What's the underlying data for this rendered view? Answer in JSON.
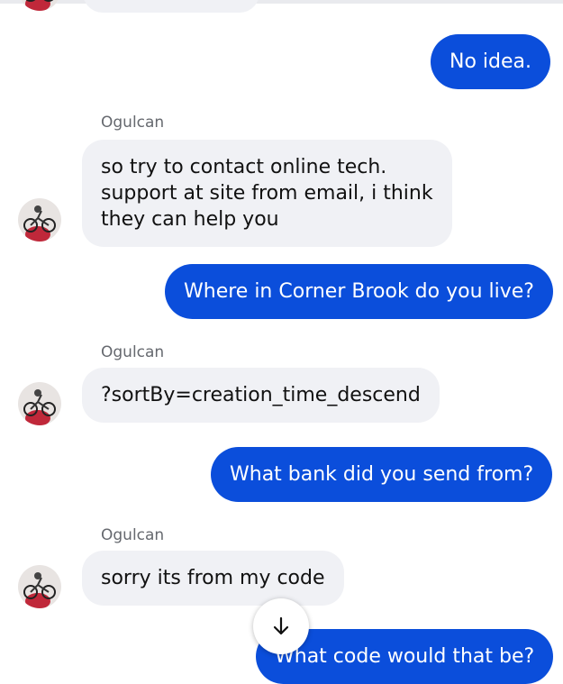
{
  "conversation": {
    "messages": [
      {
        "direction": "out",
        "text": "No idea."
      },
      {
        "direction": "in",
        "sender": "Ogulcan",
        "lines": [
          "so try to contact online tech.",
          "support at site from email, i think",
          "they can help you"
        ]
      },
      {
        "direction": "out",
        "text": "Where in Corner Brook do you live?"
      },
      {
        "direction": "in",
        "sender": "Ogulcan",
        "lines": [
          "?sortBy=creation_time_descend"
        ]
      },
      {
        "direction": "out",
        "text": "What bank did you send from?"
      },
      {
        "direction": "in",
        "sender": "Ogulcan",
        "lines": [
          "sorry its from my code"
        ]
      },
      {
        "direction": "out",
        "text": "What code would that be?"
      }
    ]
  },
  "controls": {
    "scroll_down_icon": "arrow-down-icon"
  },
  "colors": {
    "outgoing_bubble": "#0b4edb",
    "incoming_bubble": "#f0f1f5",
    "sender_name": "#65686e"
  }
}
